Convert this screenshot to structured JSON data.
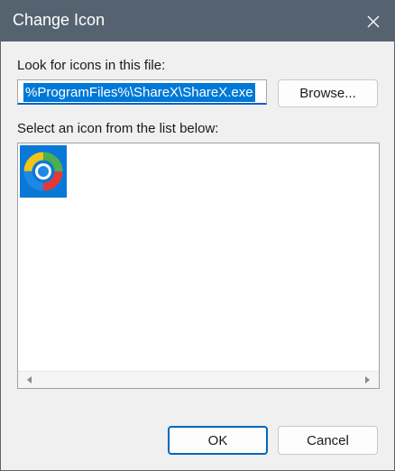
{
  "window": {
    "title": "Change Icon"
  },
  "file_section": {
    "label": "Look for icons in this file:",
    "path_value": "%ProgramFiles%\\ShareX\\ShareX.exe",
    "browse_label": "Browse..."
  },
  "icons_section": {
    "label": "Select an icon from the list below:",
    "icons": [
      {
        "name": "sharex-icon",
        "selected": true
      }
    ]
  },
  "footer": {
    "ok_label": "OK",
    "cancel_label": "Cancel"
  },
  "colors": {
    "titlebar": "#556371",
    "selection": "#0078d7",
    "accent": "#0067c0"
  }
}
